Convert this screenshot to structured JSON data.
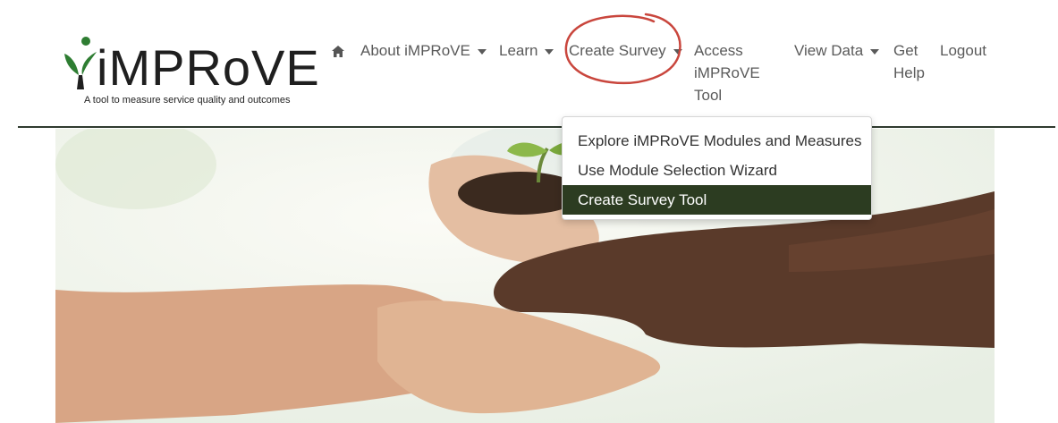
{
  "brand": {
    "name": "iMPRoVE",
    "tagline": "A tool to measure service quality and outcomes",
    "color_dark": "#1f1f1f",
    "color_green": "#2e7d32"
  },
  "nav": {
    "home_icon": "home-icon",
    "about": "About iMPRoVE",
    "learn": "Learn",
    "create_survey": "Create Survey",
    "access_line1": "Access",
    "access_line2": "iMPRoVE",
    "access_line3": "Tool",
    "view_data": "View Data",
    "get_help_line1": "Get",
    "get_help_line2": "Help",
    "logout": "Logout"
  },
  "dropdown": {
    "items": [
      {
        "label": "Explore iMPRoVE Modules and Measures"
      },
      {
        "label": "Use Module Selection Wizard"
      },
      {
        "label": "Create Survey Tool",
        "active": true
      }
    ],
    "active_color": "#2c3c21"
  },
  "annotation": {
    "circle_color": "#c9463d"
  },
  "hero": {
    "image": "hands holding soil with seedling"
  }
}
